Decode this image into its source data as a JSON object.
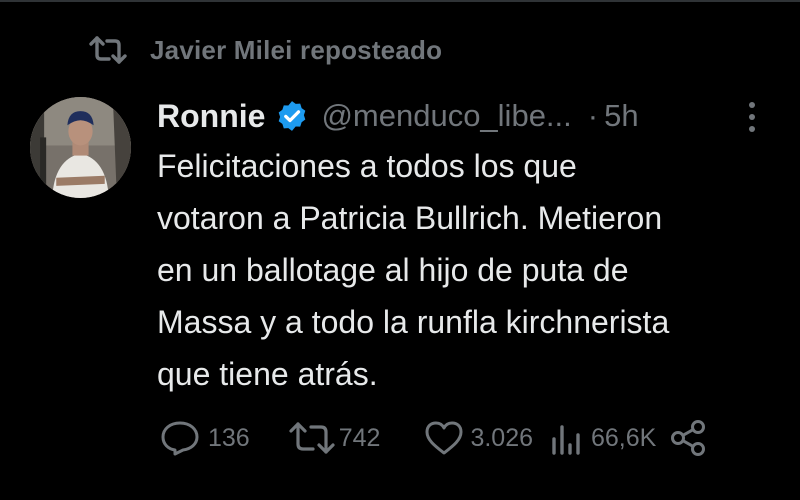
{
  "repost": {
    "text": "Javier Milei reposteado",
    "icon": "repost-icon"
  },
  "author": {
    "name": "Ronnie",
    "verified_icon": "verified-badge-icon",
    "verified_color": "#1d9bf0",
    "handle": "@menduco_libe...",
    "separator": "·",
    "time": "5h"
  },
  "post": {
    "lines": [
      "Felicitaciones a todos los que",
      "votaron a Patricia Bullrich. Metieron",
      "en un ballotage al hijo de puta de",
      "Massa y a todo la runfla kirchnerista",
      "que tiene atrás."
    ]
  },
  "actions": {
    "replies": "136",
    "reposts": "742",
    "likes": "3.026",
    "views": "66,6K"
  },
  "colors": {
    "background": "#000000",
    "text": "#e7e9ea",
    "secondary": "#71767b",
    "divider": "#2f3336"
  }
}
